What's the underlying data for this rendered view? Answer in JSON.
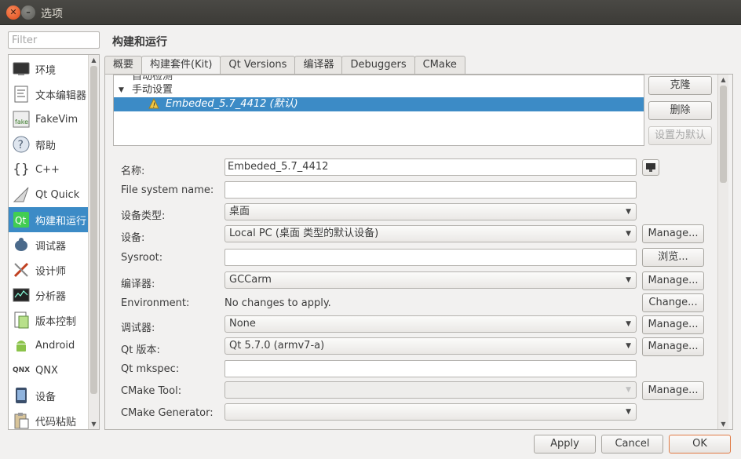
{
  "window": {
    "title": "选项"
  },
  "filter": {
    "placeholder": "Filter"
  },
  "categories": [
    {
      "label": "环境",
      "icon": "monitor-icon"
    },
    {
      "label": "文本编辑器",
      "icon": "text-editor-icon"
    },
    {
      "label": "FakeVim",
      "icon": "fakevim-icon"
    },
    {
      "label": "帮助",
      "icon": "help-icon"
    },
    {
      "label": "C++",
      "icon": "braces-icon"
    },
    {
      "label": "Qt Quick",
      "icon": "qtquick-icon"
    },
    {
      "label": "构建和运行",
      "icon": "qt-build-run-icon"
    },
    {
      "label": "调试器",
      "icon": "debugger-icon"
    },
    {
      "label": "设计师",
      "icon": "designer-icon"
    },
    {
      "label": "分析器",
      "icon": "analyzer-icon"
    },
    {
      "label": "版本控制",
      "icon": "version-control-icon"
    },
    {
      "label": "Android",
      "icon": "android-icon"
    },
    {
      "label": "QNX",
      "icon": "qnx-icon"
    },
    {
      "label": "设备",
      "icon": "device-icon"
    },
    {
      "label": "代码粘贴",
      "icon": "code-paste-icon"
    }
  ],
  "selected_category": "构建和运行",
  "page": {
    "heading": "构建和运行"
  },
  "tabs": [
    "概要",
    "构建套件(Kit)",
    "Qt Versions",
    "编译器",
    "Debuggers",
    "CMake"
  ],
  "active_tab": "构建套件(Kit)",
  "kit_tree": {
    "auto_group": "自动检测",
    "manual_group": "手动设置",
    "selected_kit": "Embeded_5.7_4412 (默认)"
  },
  "kit_buttons": {
    "clone": "克隆",
    "delete": "删除",
    "make_default": "设置为默认"
  },
  "form": {
    "name": {
      "label": "名称:",
      "value": "Embeded_5.7_4412"
    },
    "filesystem": {
      "label": "File system name:",
      "value": ""
    },
    "device_type": {
      "label": "设备类型:",
      "value": "桌面"
    },
    "device": {
      "label": "设备:",
      "value": "Local PC (桌面 类型的默认设备)",
      "button": "Manage..."
    },
    "sysroot": {
      "label": "Sysroot:",
      "value": "",
      "button": "浏览..."
    },
    "compiler": {
      "label": "编译器:",
      "value": "GCCarm",
      "button": "Manage..."
    },
    "environment": {
      "label": "Environment:",
      "value": "No changes to apply.",
      "button": "Change..."
    },
    "debugger": {
      "label": "调试器:",
      "value": "None",
      "button": "Manage..."
    },
    "qt_version": {
      "label": "Qt 版本:",
      "value": "Qt 5.7.0 (armv7-a)",
      "button": "Manage..."
    },
    "qt_mkspec": {
      "label": "Qt mkspec:",
      "value": ""
    },
    "cmake_tool": {
      "label": "CMake Tool:",
      "value": "",
      "button": "Manage..."
    },
    "cmake_generator": {
      "label": "CMake Generator:",
      "value": ""
    }
  },
  "dialog_buttons": {
    "apply": "Apply",
    "cancel": "Cancel",
    "ok": "OK"
  }
}
